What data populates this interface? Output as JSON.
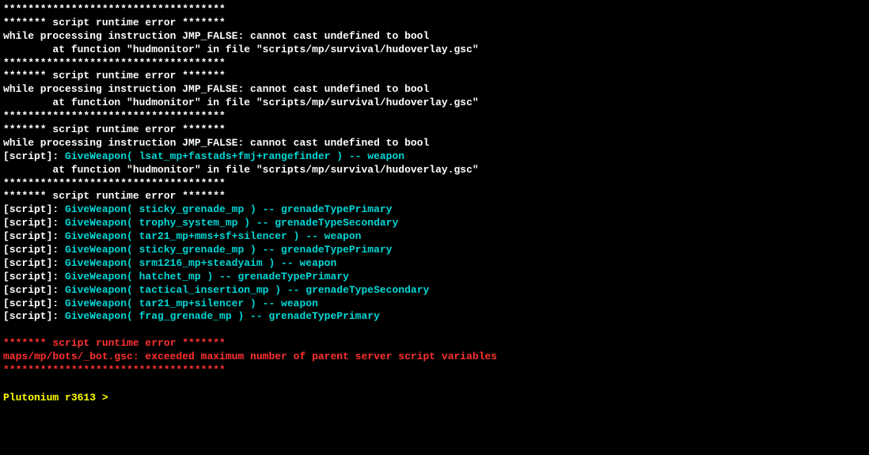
{
  "lines": [
    {
      "segments": [
        {
          "text": "************************************",
          "color": "white"
        }
      ]
    },
    {
      "segments": [
        {
          "text": "******* script runtime error *******",
          "color": "white"
        }
      ]
    },
    {
      "segments": [
        {
          "text": "while processing instruction JMP_FALSE: cannot cast undefined to bool",
          "color": "white"
        }
      ]
    },
    {
      "segments": [
        {
          "text": "        at function \"hudmonitor\" in file \"scripts/mp/survival/hudoverlay.gsc\"",
          "color": "white"
        }
      ]
    },
    {
      "segments": [
        {
          "text": "************************************",
          "color": "white"
        }
      ]
    },
    {
      "segments": [
        {
          "text": "******* script runtime error *******",
          "color": "white"
        }
      ]
    },
    {
      "segments": [
        {
          "text": "while processing instruction JMP_FALSE: cannot cast undefined to bool",
          "color": "white"
        }
      ]
    },
    {
      "segments": [
        {
          "text": "        at function \"hudmonitor\" in file \"scripts/mp/survival/hudoverlay.gsc\"",
          "color": "white"
        }
      ]
    },
    {
      "segments": [
        {
          "text": "************************************",
          "color": "white"
        }
      ]
    },
    {
      "segments": [
        {
          "text": "******* script runtime error *******",
          "color": "white"
        }
      ]
    },
    {
      "segments": [
        {
          "text": "while processing instruction JMP_FALSE: cannot cast undefined to bool",
          "color": "white"
        }
      ]
    },
    {
      "segments": [
        {
          "text": "[script]: ",
          "color": "white"
        },
        {
          "text": "GiveWeapon( lsat_mp+fastads+fmj+rangefinder ) -- weapon",
          "color": "cyan"
        }
      ]
    },
    {
      "segments": [
        {
          "text": "        at function \"hudmonitor\" in file \"scripts/mp/survival/hudoverlay.gsc\"",
          "color": "white"
        }
      ]
    },
    {
      "segments": [
        {
          "text": "************************************",
          "color": "white"
        }
      ]
    },
    {
      "segments": [
        {
          "text": "******* script runtime error *******",
          "color": "white"
        }
      ]
    },
    {
      "segments": [
        {
          "text": "[script]: ",
          "color": "white"
        },
        {
          "text": "GiveWeapon( sticky_grenade_mp ) -- grenadeTypePrimary",
          "color": "cyan"
        }
      ]
    },
    {
      "segments": [
        {
          "text": "[script]: ",
          "color": "white"
        },
        {
          "text": "GiveWeapon( trophy_system_mp ) -- grenadeTypeSecondary",
          "color": "cyan"
        }
      ]
    },
    {
      "segments": [
        {
          "text": "[script]: ",
          "color": "white"
        },
        {
          "text": "GiveWeapon( tar21_mp+mms+sf+silencer ) -- weapon",
          "color": "cyan"
        }
      ]
    },
    {
      "segments": [
        {
          "text": "[script]: ",
          "color": "white"
        },
        {
          "text": "GiveWeapon( sticky_grenade_mp ) -- grenadeTypePrimary",
          "color": "cyan"
        }
      ]
    },
    {
      "segments": [
        {
          "text": "[script]: ",
          "color": "white"
        },
        {
          "text": "GiveWeapon( srm1216_mp+steadyaim ) -- weapon",
          "color": "cyan"
        }
      ]
    },
    {
      "segments": [
        {
          "text": "[script]: ",
          "color": "white"
        },
        {
          "text": "GiveWeapon( hatchet_mp ) -- grenadeTypePrimary",
          "color": "cyan"
        }
      ]
    },
    {
      "segments": [
        {
          "text": "[script]: ",
          "color": "white"
        },
        {
          "text": "GiveWeapon( tactical_insertion_mp ) -- grenadeTypeSecondary",
          "color": "cyan"
        }
      ]
    },
    {
      "segments": [
        {
          "text": "[script]: ",
          "color": "white"
        },
        {
          "text": "GiveWeapon( tar21_mp+silencer ) -- weapon",
          "color": "cyan"
        }
      ]
    },
    {
      "segments": [
        {
          "text": "[script]: ",
          "color": "white"
        },
        {
          "text": "GiveWeapon( frag_grenade_mp ) -- grenadeTypePrimary",
          "color": "cyan"
        }
      ]
    },
    {
      "segments": [
        {
          "text": " ",
          "color": "white"
        }
      ]
    },
    {
      "segments": [
        {
          "text": "******* script runtime error *******",
          "color": "red"
        }
      ]
    },
    {
      "segments": [
        {
          "text": "maps/mp/bots/_bot.gsc: exceeded maximum number of parent server script variables",
          "color": "red"
        }
      ]
    },
    {
      "segments": [
        {
          "text": "************************************",
          "color": "red"
        }
      ]
    },
    {
      "segments": [
        {
          "text": " ",
          "color": "white"
        }
      ]
    }
  ],
  "prompt": {
    "label": "Plutonium r3613 >",
    "cursor": " "
  }
}
